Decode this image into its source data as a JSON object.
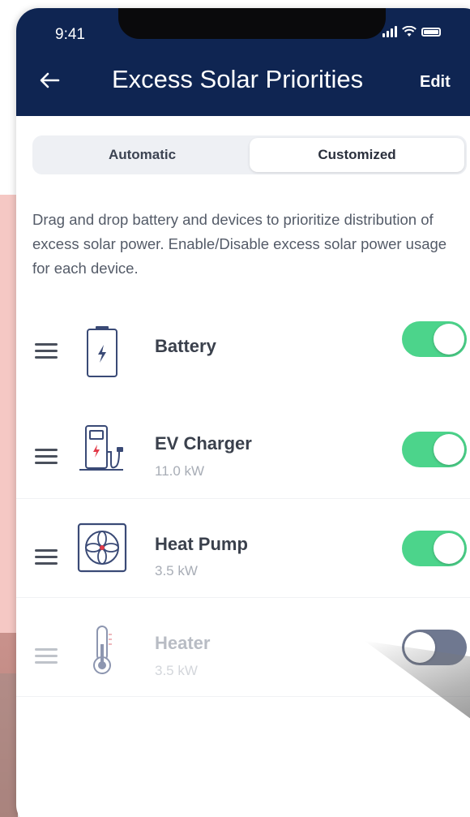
{
  "status_bar": {
    "time": "9:41"
  },
  "nav": {
    "title": "Excess Solar Priorities",
    "edit_label": "Edit"
  },
  "segmented": {
    "options": [
      "Automatic",
      "Customized"
    ],
    "selected": "Customized"
  },
  "description": "Drag and drop battery and devices to prioritize distribution of excess solar power. Enable/Disable excess solar power usage for each device.",
  "devices": [
    {
      "name": "Battery",
      "power": "",
      "enabled": true,
      "icon": "battery-icon"
    },
    {
      "name": "EV Charger",
      "power": "11.0 kW",
      "enabled": true,
      "icon": "ev-charger-icon"
    },
    {
      "name": "Heat Pump",
      "power": "3.5 kW",
      "enabled": true,
      "icon": "heat-pump-icon"
    },
    {
      "name": "Heater",
      "power": "3.5 kW",
      "enabled": false,
      "icon": "thermometer-icon"
    }
  ],
  "colors": {
    "header_bg": "#0f2552",
    "toggle_on": "#4cd48b",
    "toggle_off": "#6f7890",
    "accent_red": "#e23b4a"
  }
}
